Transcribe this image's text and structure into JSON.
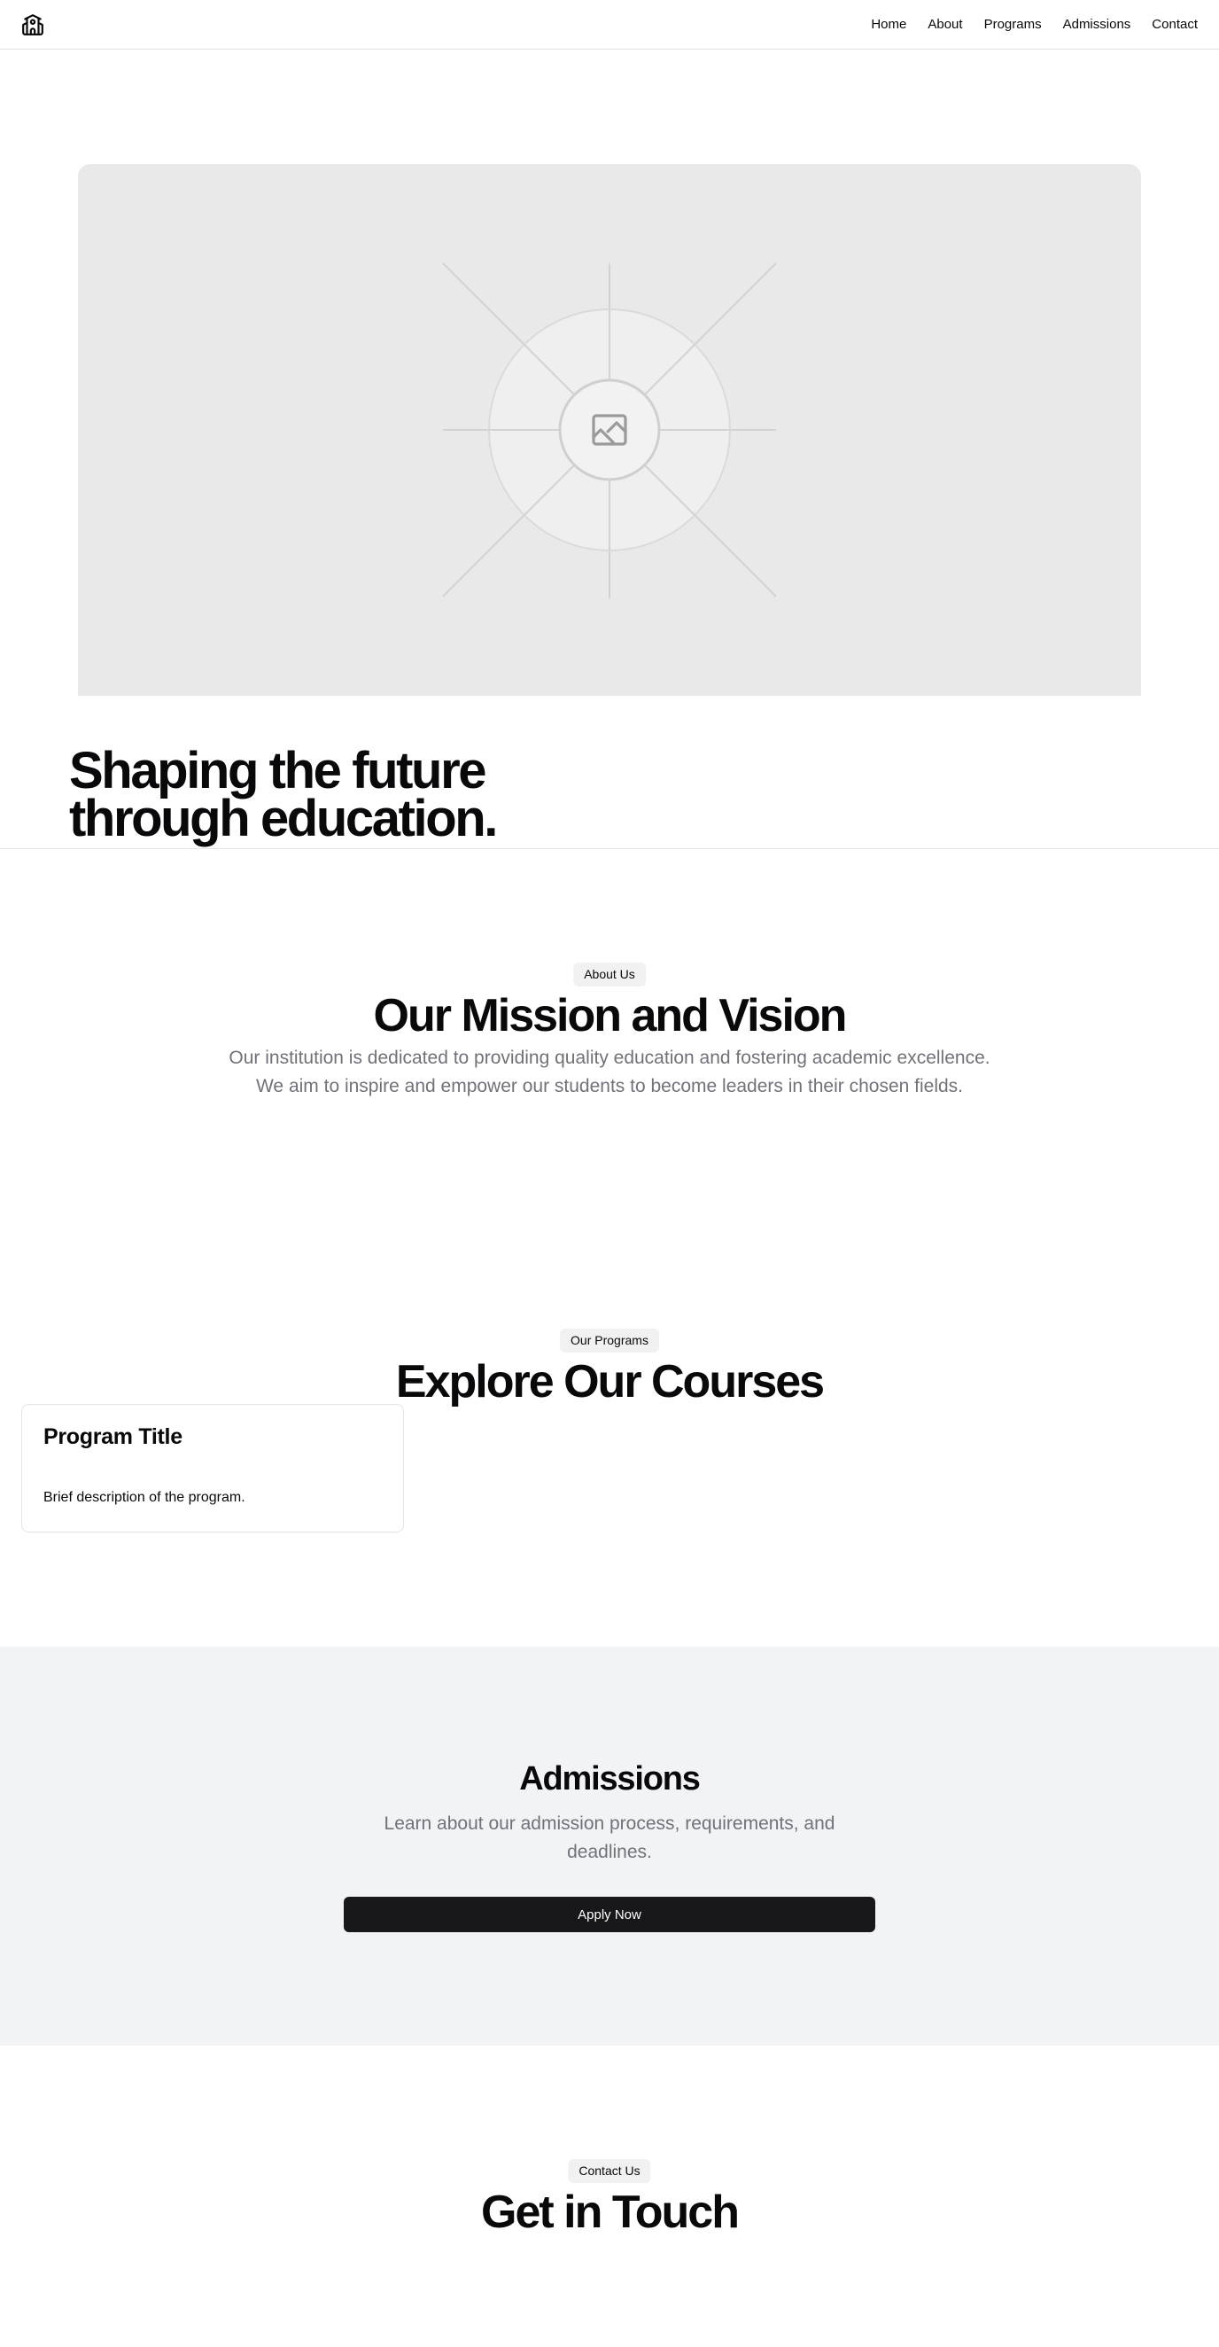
{
  "header": {
    "logo_icon": "school-building-icon",
    "nav": [
      "Home",
      "About",
      "Programs",
      "Admissions",
      "Contact"
    ]
  },
  "hero": {
    "image_icon": "image-placeholder-icon",
    "title_line1": "Shaping the future",
    "title_line2": "through education."
  },
  "about": {
    "badge": "About Us",
    "title": "Our Mission and Vision",
    "text_line1": "Our institution is dedicated to providing quality education and fostering academic excellence.",
    "text_line2": "We aim to inspire and empower our students to become leaders in their chosen fields."
  },
  "programs": {
    "badge": "Our Programs",
    "title": "Explore Our Courses",
    "card": {
      "title": "Program Title",
      "description": "Brief description of the program."
    }
  },
  "admissions": {
    "title": "Admissions",
    "text_line1": "Learn about our admission process, requirements, and",
    "text_line2": "deadlines.",
    "button": "Apply Now"
  },
  "contact": {
    "badge": "Contact Us",
    "title": "Get in Touch"
  },
  "colors": {
    "text": "#09090b",
    "muted": "#71717a",
    "button": "#18181b",
    "section_bg": "#f2f3f5",
    "placeholder_bg": "#e9e9e9"
  }
}
